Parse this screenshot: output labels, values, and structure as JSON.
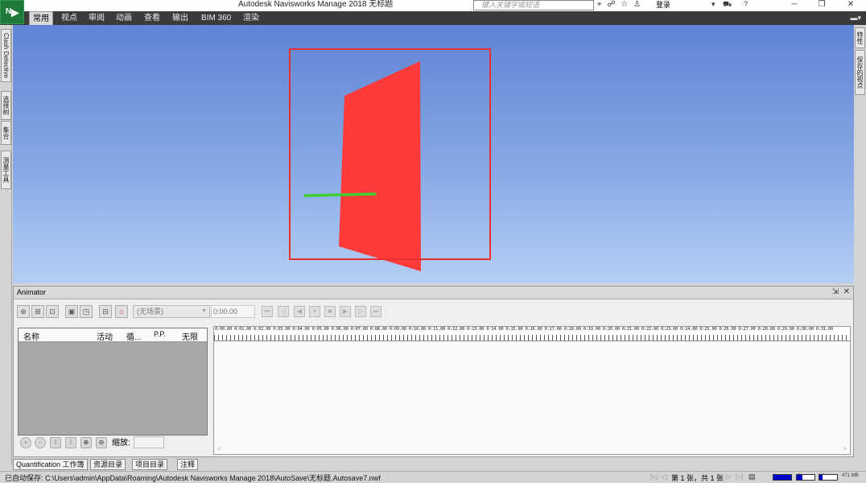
{
  "title_bar": {
    "app_logo": "N",
    "title": "Autodesk Navisworks Manage 2018    无标题",
    "search_placeholder": "键入关键字或短语",
    "login_label": "登录",
    "icons": [
      "binoculars-icon",
      "user-search-icon",
      "star-icon",
      "user-icon",
      "cart-icon",
      "help-icon"
    ]
  },
  "menu": {
    "items": [
      "常用",
      "视点",
      "审阅",
      "动画",
      "查看",
      "输出",
      "BIM 360",
      "渲染"
    ],
    "active_index": 0
  },
  "left_tabs": [
    "Clash Detective",
    "选择树",
    "集合",
    "测量工具"
  ],
  "right_tabs": [
    "特性",
    "保存的视点"
  ],
  "viewport": {
    "colors": {
      "sky_top": "#5f84d4",
      "sky_bottom": "#b5cff3",
      "wall": "#ff3a3a",
      "selection_box": "#e8312f",
      "bar": "#3fcf2f"
    }
  },
  "animator": {
    "title": "Animator",
    "scene_select": "(无场景)",
    "time_value": "0:00.00",
    "columns": [
      "名称",
      "活动",
      "循...",
      "P.P.",
      "无限"
    ],
    "scale_label": "缩放:",
    "ruler_labels": "0:00.00 0:01.00 0:02.00 0:03.00 0:04.00 0:05.00 0:06.00 0:07.00 0:08.00 0:09.00 0:10.00 0:11.00 0:12.00 0:13.00 0:14.00 0:15.00 0:16.00 0:17.00 0:18.00 0:19.00 0:20.00 0:21.00 0:22.00 0:23.00 0:24.00 0:25.00 0:26.00 0:27.00 0:28.00 0:29.00 0:30.00 0:31.00"
  },
  "bottom_tabs": [
    "Quantification 工作簿",
    "资源目录",
    "项目目录",
    "注释"
  ],
  "status": {
    "autosave_text": "已自动保存: C:\\Users\\admin\\AppData\\Roaming\\Autodesk Navisworks Manage 2018\\AutoSave\\无标题.Autosave7.nwf",
    "page_info": "第 1 张，共 1 张",
    "memory": "471 MB"
  }
}
